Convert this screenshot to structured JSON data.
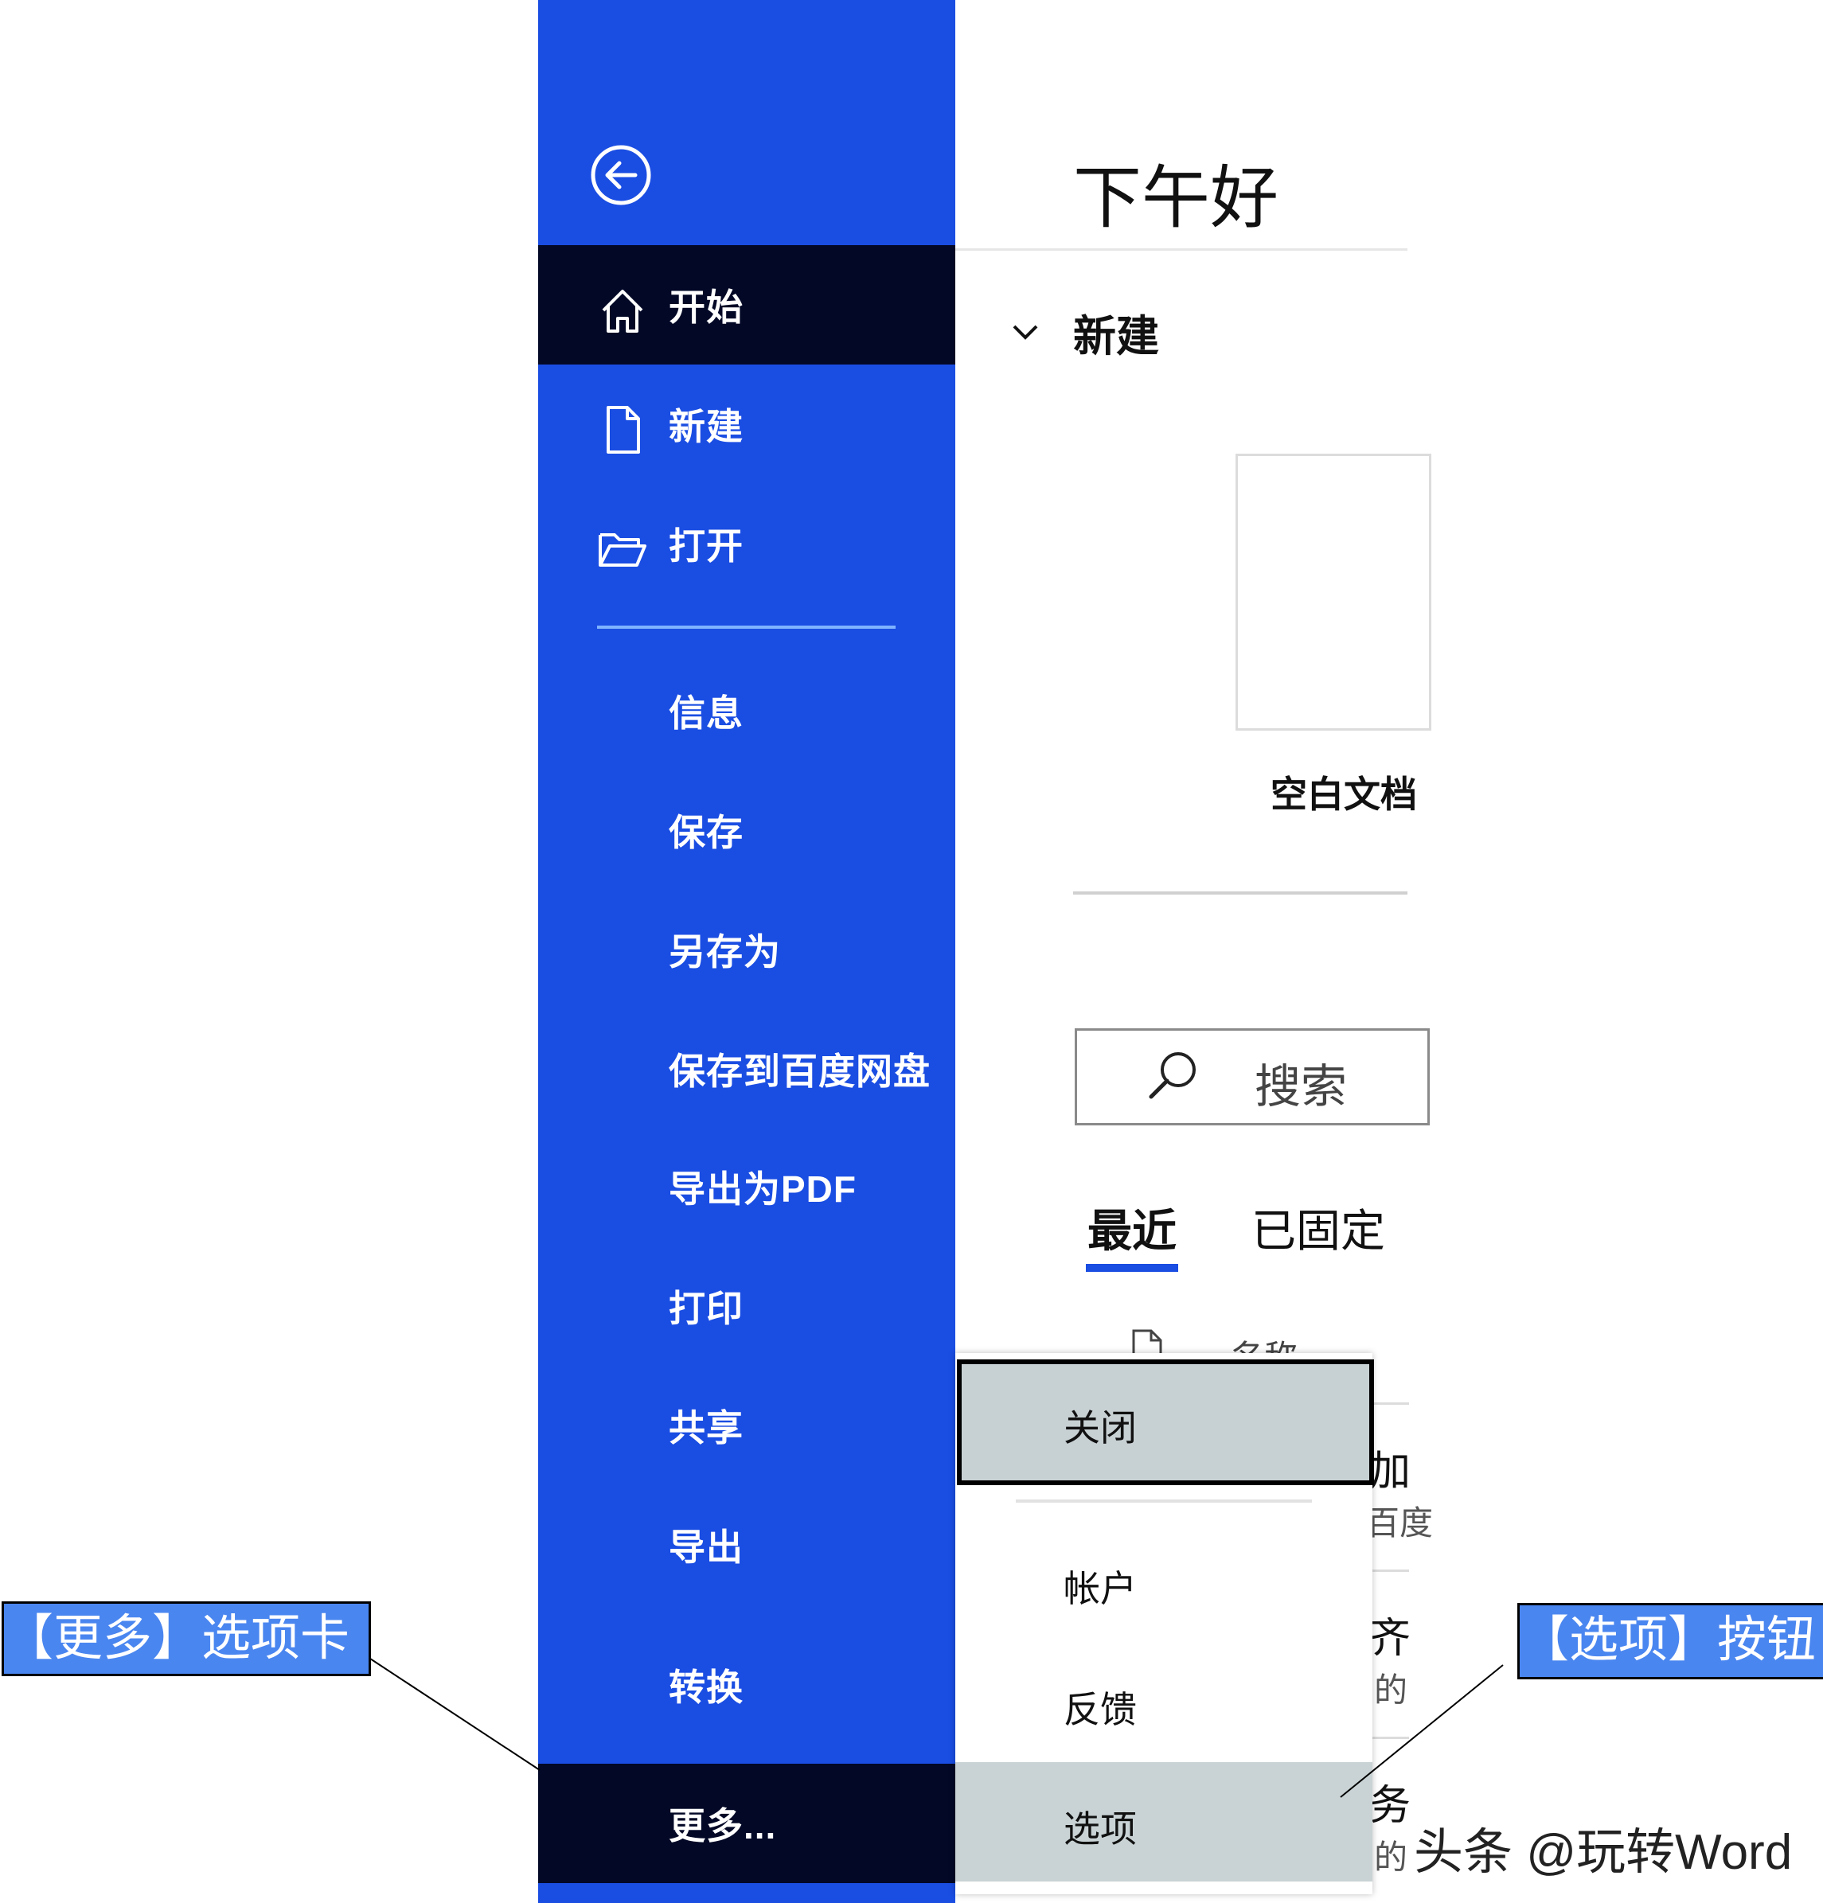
{
  "sidebar": {
    "items": [
      {
        "label": "开始",
        "icon": "home-icon",
        "active": true
      },
      {
        "label": "新建",
        "icon": "new-document-icon"
      },
      {
        "label": "打开",
        "icon": "folder-open-icon"
      },
      {
        "label": "信息"
      },
      {
        "label": "保存"
      },
      {
        "label": "另存为"
      },
      {
        "label": "保存到百度网盘"
      },
      {
        "label": "导出为PDF"
      },
      {
        "label": "打印"
      },
      {
        "label": "共享"
      },
      {
        "label": "导出"
      },
      {
        "label": "转换"
      },
      {
        "label": "更多...",
        "active": true
      }
    ]
  },
  "main": {
    "greeting": "下午好",
    "new_section": {
      "heading": "新建",
      "blank_label": "空白文档"
    },
    "search": {
      "placeholder": "搜索"
    },
    "tabs": [
      {
        "label": "最近",
        "selected": true
      },
      {
        "label": "已固定"
      }
    ],
    "list_header": {
      "name_col": "名称"
    },
    "row_fragments": [
      "加",
      "百度",
      "齐",
      "的",
      "务",
      "的"
    ]
  },
  "more_menu": {
    "items": [
      "关闭",
      "帐户",
      "反馈",
      "选项"
    ],
    "selected": "选项"
  },
  "annotations": {
    "left": "【更多】选项卡",
    "right": "【选项】按钮"
  },
  "watermark": "头条 @玩转Word",
  "colors": {
    "sidebar": "#1a4de2",
    "active_item": "#020826",
    "callout": "#4a86f0",
    "menu_highlight": "#c9d3d5"
  }
}
